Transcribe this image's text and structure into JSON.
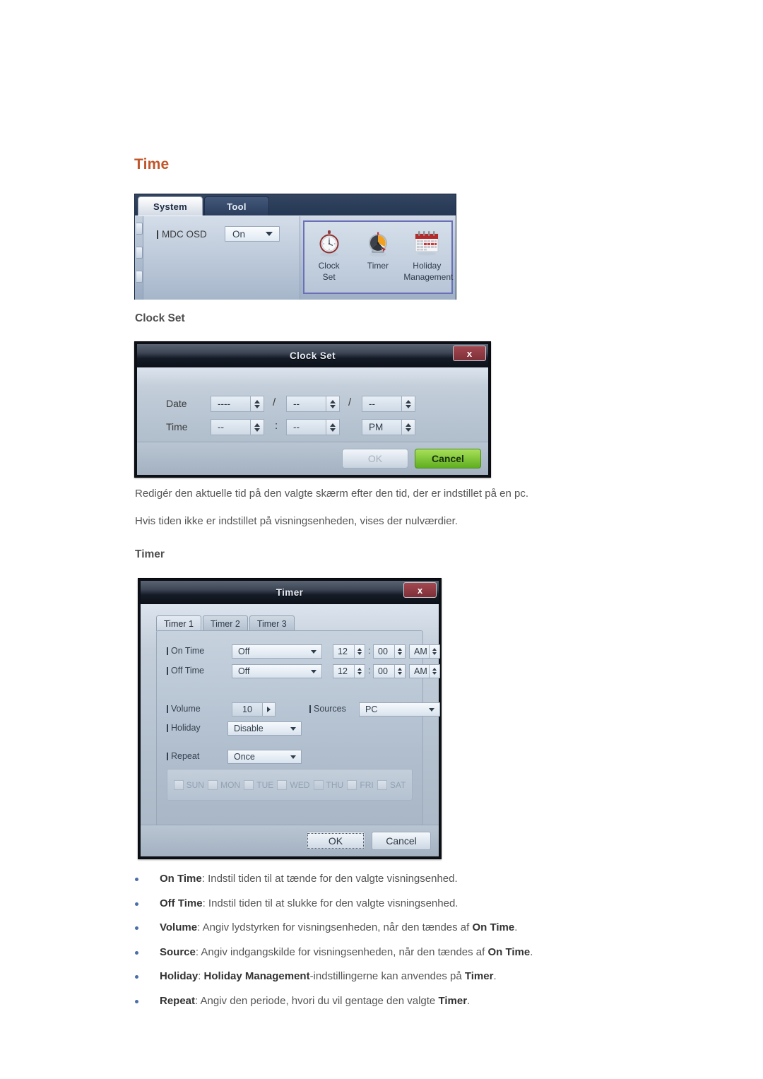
{
  "page": {
    "title": "Time",
    "title_color": "#c0562a"
  },
  "mdc_panel": {
    "tabs": [
      {
        "label": "System",
        "active": true
      },
      {
        "label": "Tool",
        "active": false
      }
    ],
    "settings": {
      "mdc_osd_label": "MDC OSD",
      "mdc_osd_value": "On"
    },
    "icons": [
      {
        "name": "clock-set",
        "line1": "Clock",
        "line2": "Set"
      },
      {
        "name": "timer",
        "line1": "Timer",
        "line2": ""
      },
      {
        "name": "holiday-management",
        "line1": "Holiday",
        "line2": "Management"
      }
    ],
    "highlight_color": "#6b6fb8"
  },
  "clock_set": {
    "section_heading": "Clock Set",
    "dialog_title": "Clock Set",
    "close_label": "x",
    "date_label": "Date",
    "time_label": "Time",
    "date_values": [
      "----",
      "--",
      "--"
    ],
    "date_separators": [
      "/",
      "/"
    ],
    "time_values": [
      "--",
      "--",
      "PM"
    ],
    "time_separator": ":",
    "ok_label": "OK",
    "cancel_label": "Cancel",
    "ok_enabled": false
  },
  "paragraphs": {
    "p1": "Redigér den aktuelle tid på den valgte skærm efter den tid, der er indstillet på en pc.",
    "p2": "Hvis tiden ikke er indstillet på visningsenheden, vises der nulværdier."
  },
  "timer": {
    "section_heading": "Timer",
    "dialog_title": "Timer",
    "close_label": "x",
    "tabs": [
      {
        "label": "Timer 1",
        "active": true
      },
      {
        "label": "Timer 2",
        "active": false
      },
      {
        "label": "Timer 3",
        "active": false
      }
    ],
    "on_time": {
      "label": "On Time",
      "mode": "Off",
      "hour": "12",
      "minute": "00",
      "meridiem": "AM"
    },
    "off_time": {
      "label": "Off Time",
      "mode": "Off",
      "hour": "12",
      "minute": "00",
      "meridiem": "AM"
    },
    "volume": {
      "label": "Volume",
      "value": "10"
    },
    "sources": {
      "label": "Sources",
      "value": "PC"
    },
    "holiday": {
      "label": "Holiday",
      "value": "Disable"
    },
    "repeat": {
      "label": "Repeat",
      "value": "Once"
    },
    "days": [
      {
        "label": "SUN",
        "checked": false
      },
      {
        "label": "MON",
        "checked": false
      },
      {
        "label": "TUE",
        "checked": false
      },
      {
        "label": "WED",
        "checked": false
      },
      {
        "label": "THU",
        "checked": false
      },
      {
        "label": "FRI",
        "checked": false
      },
      {
        "label": "SAT",
        "checked": false
      }
    ],
    "ok_label": "OK",
    "cancel_label": "Cancel",
    "colon": ":"
  },
  "bullets": [
    {
      "term": "On Time",
      "rest": ": Indstil tiden til at tænde for den valgte visningsenhed."
    },
    {
      "term": "Off Time",
      "rest": ": Indstil tiden til at slukke for den valgte visningsenhed."
    },
    {
      "term": "Volume",
      "mid": ": Angiv lydstyrken for visningsenheden, når den tændes af ",
      "term2": "On Time",
      "tail": "."
    },
    {
      "term": "Source",
      "mid": ": Angiv indgangskilde for visningsenheden, når den tændes af ",
      "term2": "On Time",
      "tail": "."
    },
    {
      "term": "Holiday",
      "mid": ": ",
      "term2": "Holiday Management",
      "mid2": "-indstillingerne kan anvendes på ",
      "term3": "Timer",
      "tail": "."
    },
    {
      "term": "Repeat",
      "mid": ": Angiv den periode, hvori du vil gentage den valgte ",
      "term2": "Timer",
      "tail": "."
    }
  ]
}
